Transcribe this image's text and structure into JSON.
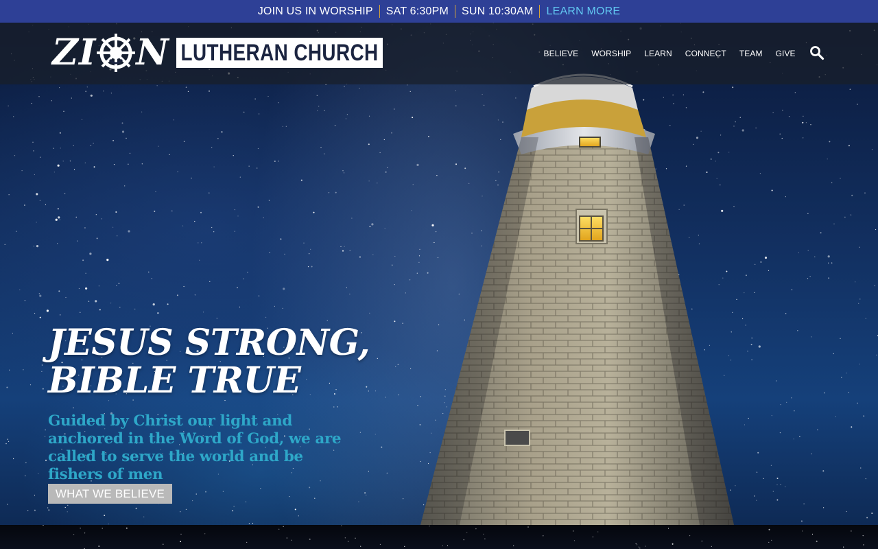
{
  "topbar": {
    "join": "JOIN US IN WORSHIP",
    "sat": "SAT 6:30PM",
    "sun": "SUN 10:30AM",
    "learn_more": "LEARN MORE"
  },
  "header": {
    "logo_left": "ZI",
    "logo_right": "N",
    "logo_box": "LUTHERAN CHURCH",
    "nav": [
      "BELIEVE",
      "WORSHIP",
      "LEARN",
      "CONNECT",
      "TEAM",
      "GIVE"
    ],
    "search_icon": "search-icon"
  },
  "hero": {
    "headline_line1": "JESUS STRONG,",
    "headline_line2": "BIBLE TRUE",
    "subtext": "Guided by Christ our light and anchored in the Word of God, we are called to serve the world and be fishers of men",
    "cta": "WHAT WE BELIEVE"
  },
  "colors": {
    "topbar_bg": "#2e4096",
    "divider": "#d6a43a",
    "learn_more": "#62c8f2",
    "subtext": "#2ea7c8",
    "cta_bg": "#b9b9b9"
  }
}
